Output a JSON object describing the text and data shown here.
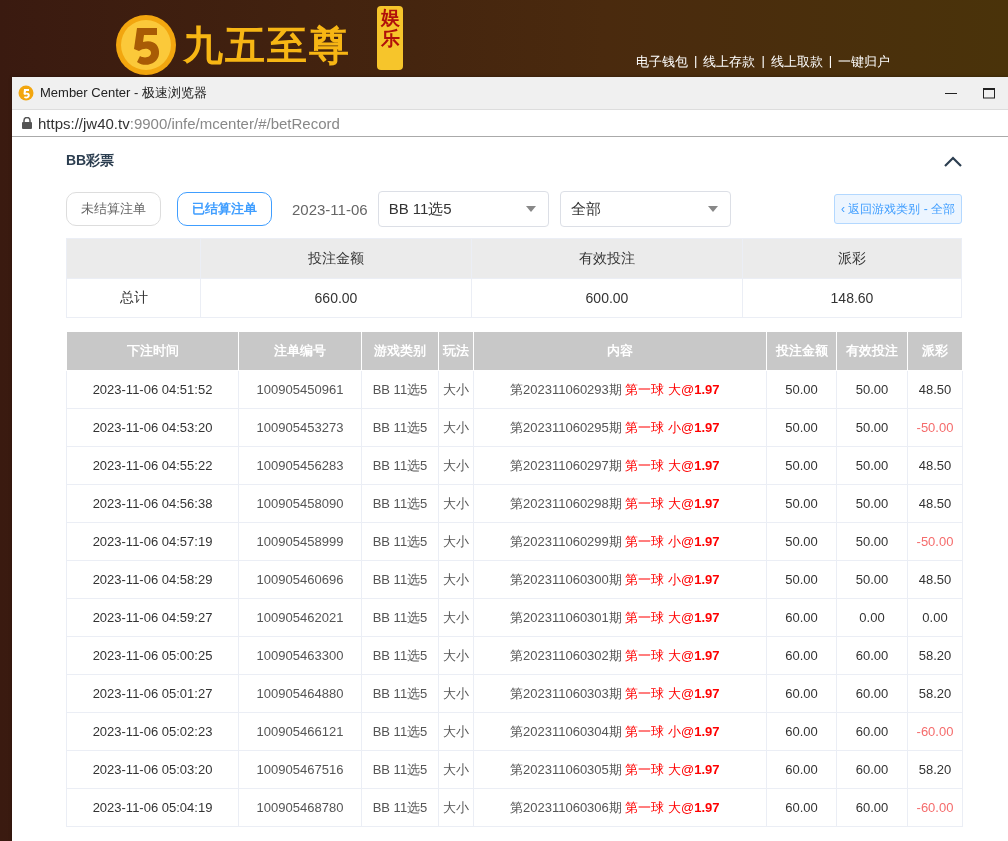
{
  "banner": {
    "logo_text": "九五至尊",
    "logo_badge": "娱乐",
    "links": [
      "电子钱包",
      "线上存款",
      "线上取款",
      "一键归户"
    ],
    "separator": "|"
  },
  "browser": {
    "title": "Member Center - 极速浏览器",
    "url_host": "https://jw40.tv",
    "url_rest": ":9900/infe/mcenter/#/betRecord"
  },
  "panel": {
    "title": "BB彩票",
    "expanded": true,
    "filters": [
      {
        "label": "未结算注单",
        "selected": false
      },
      {
        "label": "已结算注单",
        "selected": true
      }
    ],
    "date": "2023-11-06",
    "game_select": {
      "value": "BB 11选5"
    },
    "play_select": {
      "value": "全部"
    },
    "back_button": "‹ 返回游戏类别 - 全部"
  },
  "summary": {
    "columns": [
      "投注金额",
      "有效投注",
      "派彩"
    ],
    "row_label": "总计",
    "values": [
      "660.00",
      "600.00",
      "148.60"
    ]
  },
  "bets": {
    "columns": [
      "下注时间",
      "注单编号",
      "游戏类别",
      "玩法",
      "内容",
      "投注金额",
      "有效投注",
      "派彩"
    ],
    "rows": [
      {
        "time": "2023-11-06 04:51:52",
        "id": "100905450961",
        "game": "BB 11选5",
        "play": "大小",
        "period": "第202311060293期",
        "bet": "第一球 大@**1.97**",
        "amount": "50.00",
        "valid": "50.00",
        "payout": "48.50",
        "loss": false
      },
      {
        "time": "2023-11-06 04:53:20",
        "id": "100905453273",
        "game": "BB 11选5",
        "play": "大小",
        "period": "第202311060295期",
        "bet": "第一球 小@**1.97**",
        "amount": "50.00",
        "valid": "50.00",
        "payout": "-50.00",
        "loss": true
      },
      {
        "time": "2023-11-06 04:55:22",
        "id": "100905456283",
        "game": "BB 11选5",
        "play": "大小",
        "period": "第202311060297期",
        "bet": "第一球 大@**1.97**",
        "amount": "50.00",
        "valid": "50.00",
        "payout": "48.50",
        "loss": false
      },
      {
        "time": "2023-11-06 04:56:38",
        "id": "100905458090",
        "game": "BB 11选5",
        "play": "大小",
        "period": "第202311060298期",
        "bet": "第一球 大@**1.97**",
        "amount": "50.00",
        "valid": "50.00",
        "payout": "48.50",
        "loss": false
      },
      {
        "time": "2023-11-06 04:57:19",
        "id": "100905458999",
        "game": "BB 11选5",
        "play": "大小",
        "period": "第202311060299期",
        "bet": "第一球 小@**1.97**",
        "amount": "50.00",
        "valid": "50.00",
        "payout": "-50.00",
        "loss": true
      },
      {
        "time": "2023-11-06 04:58:29",
        "id": "100905460696",
        "game": "BB 11选5",
        "play": "大小",
        "period": "第202311060300期",
        "bet": "第一球 小@**1.97**",
        "amount": "50.00",
        "valid": "50.00",
        "payout": "48.50",
        "loss": false
      },
      {
        "time": "2023-11-06 04:59:27",
        "id": "100905462021",
        "game": "BB 11选5",
        "play": "大小",
        "period": "第202311060301期",
        "bet": "第一球 大@**1.97**",
        "amount": "60.00",
        "valid": "0.00",
        "payout": "0.00",
        "loss": false
      },
      {
        "time": "2023-11-06 05:00:25",
        "id": "100905463300",
        "game": "BB 11选5",
        "play": "大小",
        "period": "第202311060302期",
        "bet": "第一球 大@**1.97**",
        "amount": "60.00",
        "valid": "60.00",
        "payout": "58.20",
        "loss": false
      },
      {
        "time": "2023-11-06 05:01:27",
        "id": "100905464880",
        "game": "BB 11选5",
        "play": "大小",
        "period": "第202311060303期",
        "bet": "第一球 大@**1.97**",
        "amount": "60.00",
        "valid": "60.00",
        "payout": "58.20",
        "loss": false
      },
      {
        "time": "2023-11-06 05:02:23",
        "id": "100905466121",
        "game": "BB 11选5",
        "play": "大小",
        "period": "第202311060304期",
        "bet": "第一球 小@**1.97**",
        "amount": "60.00",
        "valid": "60.00",
        "payout": "-60.00",
        "loss": true
      },
      {
        "time": "2023-11-06 05:03:20",
        "id": "100905467516",
        "game": "BB 11选5",
        "play": "大小",
        "period": "第202311060305期",
        "bet": "第一球 大@**1.97**",
        "amount": "60.00",
        "valid": "60.00",
        "payout": "58.20",
        "loss": false
      },
      {
        "time": "2023-11-06 05:04:19",
        "id": "100905468780",
        "game": "BB 11选5",
        "play": "大小",
        "period": "第202311060306期",
        "bet": "第一球 大@**1.97**",
        "amount": "60.00",
        "valid": "60.00",
        "payout": "-60.00",
        "loss": true
      }
    ]
  }
}
